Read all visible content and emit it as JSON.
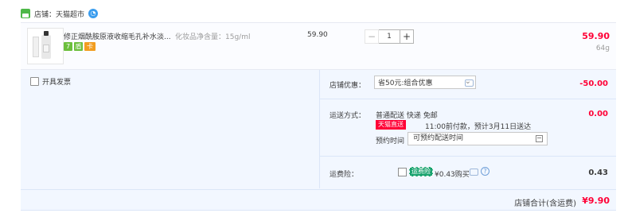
{
  "shop": {
    "label": "店铺：",
    "name": "天猫超市"
  },
  "item": {
    "title": "修正烟酰胺原液收缩毛孔补水淡...",
    "sku": "化妆品净含量：15g/ml",
    "unit_price": "59.90",
    "quantity": "1",
    "minus": "−",
    "plus": "+",
    "sum": "59.90",
    "weight": "64g",
    "badges": [
      "7",
      "盾",
      "卡"
    ]
  },
  "invoice": {
    "label": "开具发票"
  },
  "discount": {
    "label": "店铺优惠：",
    "selected": "省50元:组合优惠",
    "amount": "-50.00"
  },
  "shipping": {
    "label": "运送方式：",
    "method": "普通配送 快递 免邮",
    "tmall_tag": "天猫直送",
    "promise": "11:00前付款，预计3月11日送达",
    "reserve_label": "预约时间",
    "reserve_placeholder": "可预约配送时间",
    "amount": "0.00"
  },
  "insurance": {
    "label": "运费险：",
    "tag": "运费险",
    "text": "¥0.43购买",
    "amount": "0.43"
  },
  "total": {
    "label": "店铺合计(含运费)",
    "value": "¥9.90"
  },
  "colors": {
    "price_red": "#ff0036",
    "panel_bg": "#f2f7ff"
  }
}
